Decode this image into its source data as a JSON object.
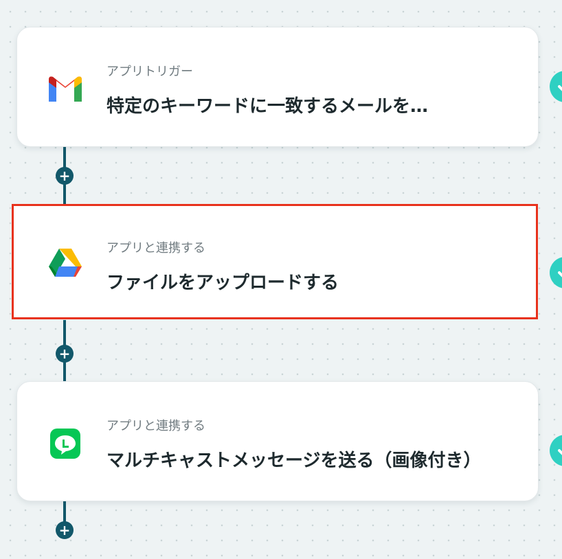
{
  "flow": {
    "steps": [
      {
        "type_label": "アプリトリガー",
        "title": "特定のキーワードに一致するメールを…",
        "app_icon": "gmail-icon"
      },
      {
        "type_label": "アプリと連携する",
        "title": "ファイルをアップロードする",
        "app_icon": "google-drive-icon",
        "selected": true
      },
      {
        "type_label": "アプリと連携する",
        "title": "マルチキャストメッセージを送る（画像付き）",
        "app_icon": "line-icon"
      }
    ],
    "add_button_label": "+",
    "colors": {
      "connector": "#12586a",
      "highlight": "#e8321c",
      "status": "#2fd0c2"
    }
  }
}
